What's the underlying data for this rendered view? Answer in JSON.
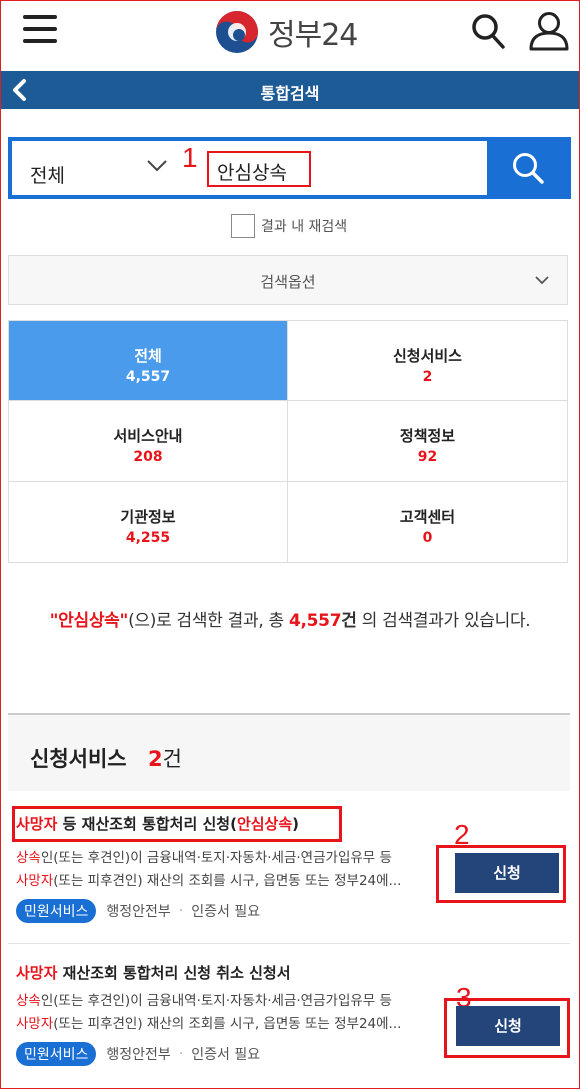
{
  "header": {
    "logo_text": "정부24"
  },
  "titlebar": {
    "title": "통합검색"
  },
  "search": {
    "scope": "전체",
    "query": "안심상속",
    "marker": "1"
  },
  "research": {
    "label": "결과 내 재검색"
  },
  "options": {
    "label": "검색옵션"
  },
  "categories": [
    {
      "label": "전체",
      "count": "4,557",
      "active": true
    },
    {
      "label": "신청서비스",
      "count": "2"
    },
    {
      "label": "서비스안내",
      "count": "208"
    },
    {
      "label": "정책정보",
      "count": "92"
    },
    {
      "label": "기관정보",
      "count": "4,255"
    },
    {
      "label": "고객센터",
      "count": "0"
    }
  ],
  "summary": {
    "query_quoted": "\"안심상속\"",
    "text1": "(으)로 검색한 결과, 총 ",
    "count": "4,557",
    "unit": "건",
    "text2": " 의 검색결과가 있습니다."
  },
  "section": {
    "title": "신청서비스",
    "count": "2",
    "unit": "건"
  },
  "results": [
    {
      "title_hl": "사망자",
      "title_mid": " 등 재산조회 통합처리 신청(",
      "title_hl2": "안심상속",
      "title_end": ")",
      "desc1_hl": "상속",
      "desc1": "인(또는 후견인)이 금융내역·토지·자동차·세금·연금가입유무 등",
      "desc2_hl": "사망자",
      "desc2": "(또는 피후견인) 재산의 조회를 시구, 읍면동 또는 정부24에...",
      "badge": "민원서비스",
      "agency": "행정안전부",
      "cert": "인증서 필요",
      "apply": "신청",
      "marker": "2"
    },
    {
      "title_hl": "사망자",
      "title_rest": " 재산조회 통합처리 신청 취소 신청서",
      "desc1_hl": "상속",
      "desc1": "인(또는 후견인)이 금융내역·토지·자동차·세금·연금가입유무 등",
      "desc2_hl": "사망자",
      "desc2": "(또는 피후견인) 재산의 조회를 시구, 읍면동 또는 정부24에...",
      "badge": "민원서비스",
      "agency": "행정안전부",
      "cert": "인증서 필요",
      "apply": "신청",
      "marker": "3"
    }
  ],
  "colors": {
    "brand_blue": "#1a6fd4",
    "title_bar": "#1d5b97",
    "active_tab": "#4a9bec",
    "highlight_red": "#e8141b",
    "apply_button": "#23457a"
  },
  "icons": [
    "menu-icon",
    "search-icon",
    "user-icon",
    "back-arrow-icon",
    "chevron-down-icon",
    "logo-taegeuk-icon"
  ]
}
